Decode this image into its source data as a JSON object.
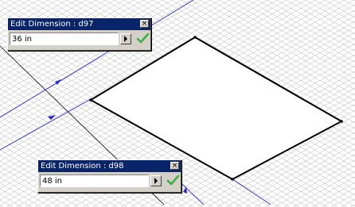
{
  "dialogs": [
    {
      "title": "Edit Dimension : d97",
      "value": "36 in",
      "close_glyph": "×",
      "icons": {
        "close": "close-icon",
        "dropdown": "dropdown-arrow-icon",
        "accept": "checkmark-icon"
      }
    },
    {
      "title": "Edit Dimension : d98",
      "value": "48 in",
      "close_glyph": "×",
      "icons": {
        "close": "close-icon",
        "dropdown": "dropdown-arrow-icon",
        "accept": "checkmark-icon"
      }
    }
  ],
  "colors": {
    "titlebar": "#0a246a",
    "dialog_face": "#d4d0c8",
    "accept_check": "#3cb043",
    "dimension_line": "#2b2bd0",
    "sketch_edge": "#000000",
    "grid": "#c8c8c8"
  }
}
